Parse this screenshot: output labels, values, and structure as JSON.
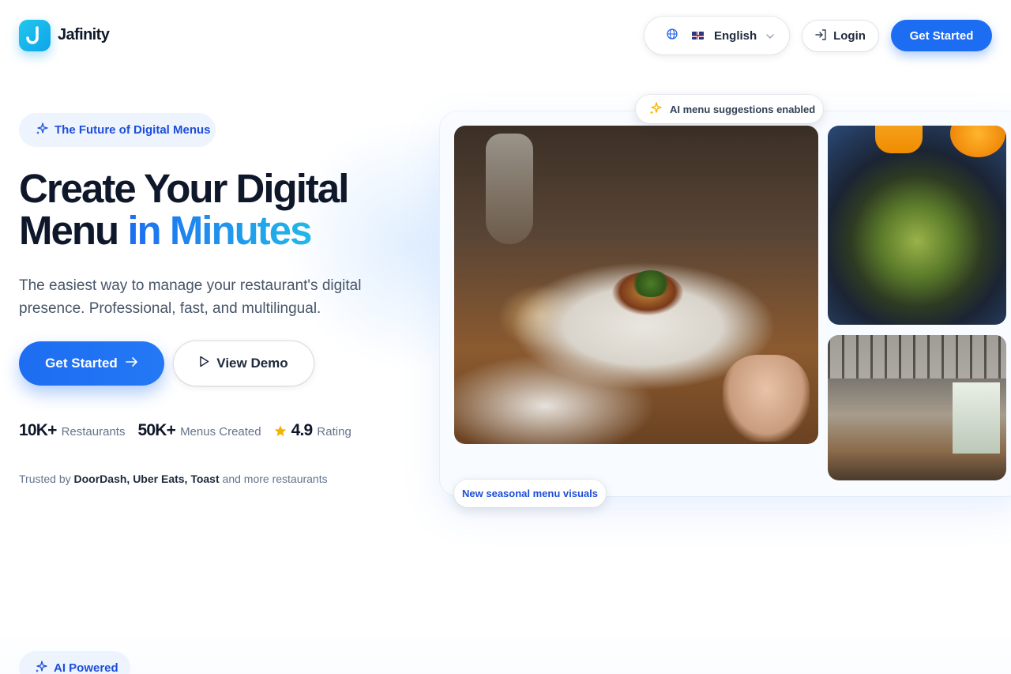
{
  "header": {
    "brand": "Jafinity",
    "language": "English",
    "login_label": "Login",
    "cta_label": "Get Started"
  },
  "hero": {
    "badge": "The Future of Digital Menus",
    "title_line1": "Create Your Digital",
    "title_line2_plain": "Menu ",
    "title_line2_accent": "in Minutes",
    "subtitle": "The easiest way to manage your restaurant's digital presence. Professional, fast, and multilingual.",
    "primary_cta": "Get Started",
    "secondary_cta": "View Demo",
    "stats": [
      {
        "value": "10K+",
        "label": "Restaurants"
      },
      {
        "value": "50K+",
        "label": "Menus Created"
      },
      {
        "value": "4.9",
        "label": "Rating"
      }
    ],
    "trusted_prefix": "Trusted by ",
    "trusted_brands": "DoorDash, Uber Eats, Toast",
    "trusted_suffix": " and more restaurants"
  },
  "gallery": {
    "ai_pill": "AI menu suggestions enabled",
    "new_pill": "New seasonal menu visuals"
  },
  "next_section": {
    "badge": "AI Powered"
  },
  "colors": {
    "primary": "#1d6df2",
    "accent_cyan": "#22b8e8",
    "badge_bg": "#eef4fe",
    "star": "#f5b400",
    "text_dark": "#0f172a"
  },
  "icons": [
    "logo-icon",
    "globe-icon",
    "flag-uk-icon",
    "chevron-down-icon",
    "login-icon",
    "sparkles-icon",
    "arrow-right-icon",
    "play-icon",
    "star-icon"
  ]
}
